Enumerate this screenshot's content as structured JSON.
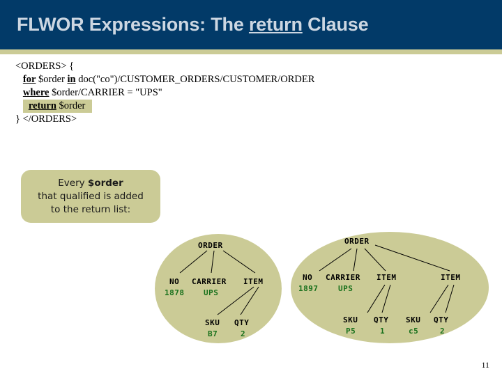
{
  "slide": {
    "title_parts": {
      "before": "FLWOR Expressions: The ",
      "underlined": "return",
      "after": " Clause"
    },
    "page_number": "11",
    "colors": {
      "header_bg": "#023a68",
      "header_text": "#cdd7e2",
      "accent_khaki": "#cbcb96",
      "value_green": "#18701b",
      "body_text": "#000000"
    }
  },
  "code": {
    "lines": [
      {
        "indent": 0,
        "segments": [
          {
            "text": "<ORDERS> {",
            "kind": "plain"
          }
        ],
        "highlight": false
      },
      {
        "indent": 1,
        "segments": [
          {
            "text": "for",
            "kind": "keyword"
          },
          {
            "text": " $order ",
            "kind": "plain"
          },
          {
            "text": "in",
            "kind": "keyword"
          },
          {
            "text": " doc(\"co\")/CUSTOMER_ORDERS/CUSTOMER/ORDER",
            "kind": "plain"
          }
        ],
        "highlight": false
      },
      {
        "indent": 1,
        "segments": [
          {
            "text": "where",
            "kind": "keyword"
          },
          {
            "text": " $order/CARRIER = \"UPS\"",
            "kind": "plain"
          }
        ],
        "highlight": false
      },
      {
        "indent": 1,
        "segments": [
          {
            "text": "return",
            "kind": "keyword"
          },
          {
            "text": " $order",
            "kind": "plain"
          }
        ],
        "highlight": true
      },
      {
        "indent": 0,
        "segments": [
          {
            "text": "} </ORDERS>",
            "kind": "plain"
          }
        ],
        "highlight": false
      }
    ]
  },
  "callout": {
    "line1_prefix": "Every ",
    "line1_bold": "$order",
    "line2": "that qualified is added",
    "line3": "to the return list:"
  },
  "trees": [
    {
      "id": "order-1878",
      "root": "ORDER",
      "nodes": [
        {
          "label": "NO",
          "value": "1878"
        },
        {
          "label": "CARRIER",
          "value": "UPS"
        },
        {
          "label": "ITEM",
          "value": null,
          "children": [
            {
              "label": "SKU",
              "value": "B7"
            },
            {
              "label": "QTY",
              "value": "2"
            }
          ]
        }
      ]
    },
    {
      "id": "order-1897",
      "root": "ORDER",
      "nodes": [
        {
          "label": "NO",
          "value": "1897"
        },
        {
          "label": "CARRIER",
          "value": "UPS"
        },
        {
          "label": "ITEM",
          "value": null,
          "children": [
            {
              "label": "SKU",
              "value": "P5"
            },
            {
              "label": "QTY",
              "value": "1"
            }
          ]
        },
        {
          "label": "ITEM",
          "value": null,
          "children": [
            {
              "label": "SKU",
              "value": "c5"
            },
            {
              "label": "QTY",
              "value": "2"
            }
          ]
        }
      ]
    }
  ],
  "tree_labels": {
    "t1_root": "ORDER",
    "t1_no": "NO",
    "t1_no_val": "1878",
    "t1_carrier": "CARRIER",
    "t1_carrier_val": "UPS",
    "t1_item": "ITEM",
    "t1_sku": "SKU",
    "t1_sku_val": "B7",
    "t1_qty": "QTY",
    "t1_qty_val": "2",
    "t2_root": "ORDER",
    "t2_no": "NO",
    "t2_no_val": "1897",
    "t2_carrier": "CARRIER",
    "t2_carrier_val": "UPS",
    "t2_item1": "ITEM",
    "t2_item2": "ITEM",
    "t2_sku1": "SKU",
    "t2_sku1_val": "P5",
    "t2_qty1": "QTY",
    "t2_qty1_val": "1",
    "t2_sku2": "SKU",
    "t2_sku2_val": "c5",
    "t2_qty2": "QTY",
    "t2_qty2_val": "2"
  }
}
